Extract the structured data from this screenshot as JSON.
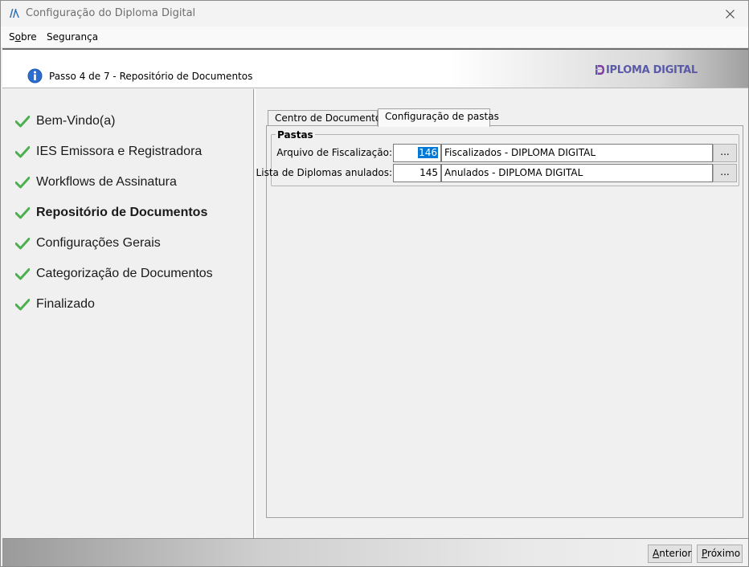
{
  "window": {
    "title": "Configuração do Diploma Digital",
    "close_icon": "close-icon"
  },
  "menu": {
    "items": [
      {
        "label": "Sobre",
        "mnemonic": "o"
      },
      {
        "label": "Segurança"
      }
    ]
  },
  "header": {
    "step_text": "Passo 4 de 7 - Repositório de Documentos",
    "logo_text": "IPLOMA DIGITAL",
    "info_icon": "info-icon"
  },
  "sidebar": {
    "steps": [
      {
        "label": "Bem-Vindo(a)",
        "done": true
      },
      {
        "label": "IES Emissora e Registradora",
        "done": true
      },
      {
        "label": "Workflows de Assinatura",
        "done": true
      },
      {
        "label": "Repositório de Documentos",
        "done": true,
        "active": true
      },
      {
        "label": "Configurações Gerais",
        "done": true
      },
      {
        "label": "Categorização de Documentos",
        "done": true
      },
      {
        "label": "Finalizado",
        "done": true
      }
    ]
  },
  "main": {
    "tabs": [
      {
        "label": "Centro de Documentos"
      },
      {
        "label": "Configuração de pastas",
        "selected": true
      }
    ],
    "group": {
      "title": "Pastas",
      "rows": [
        {
          "label": "Arquivo de Fiscalização:",
          "id": "146",
          "name": "Fiscalizados - DIPLOMA DIGITAL",
          "button": "...",
          "id_selected": true
        },
        {
          "label": "Lista de Diplomas anulados:",
          "id": "145",
          "name": "Anulados - DIPLOMA DIGITAL",
          "button": "..."
        }
      ]
    }
  },
  "footer": {
    "prev_label": "Anterior",
    "next_label": "Próximo"
  },
  "colors": {
    "check": "#4caf50",
    "accent": "#0078d7",
    "logo": "#5a5aa8",
    "info": "#1e5bb8"
  }
}
